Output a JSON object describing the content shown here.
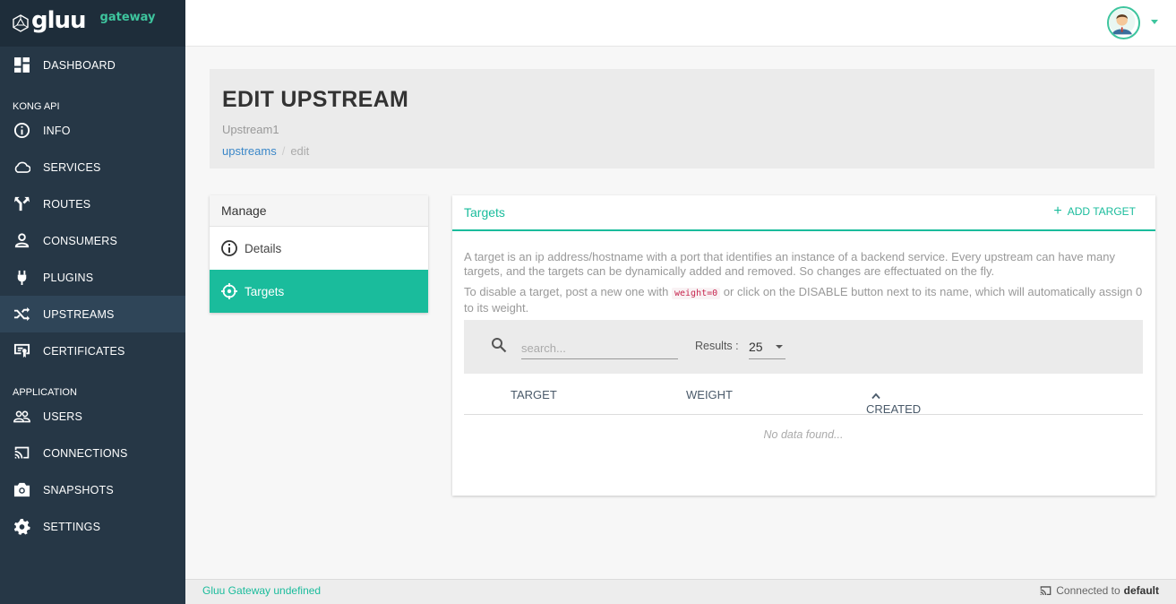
{
  "brand": {
    "name": "gluu",
    "sub": "gateway"
  },
  "sidebar": {
    "dashboard": "DASHBOARD",
    "kong_section": "KONG API",
    "kong_items": [
      {
        "label": "INFO",
        "icon": "info-icon"
      },
      {
        "label": "SERVICES",
        "icon": "cloud-icon"
      },
      {
        "label": "ROUTES",
        "icon": "fork-icon"
      },
      {
        "label": "CONSUMERS",
        "icon": "person-icon"
      },
      {
        "label": "PLUGINS",
        "icon": "plug-icon"
      },
      {
        "label": "UPSTREAMS",
        "icon": "shuffle-icon",
        "active": true
      },
      {
        "label": "CERTIFICATES",
        "icon": "certificate-icon"
      }
    ],
    "app_section": "APPLICATION",
    "app_items": [
      {
        "label": "USERS",
        "icon": "users-icon"
      },
      {
        "label": "CONNECTIONS",
        "icon": "cast-icon"
      },
      {
        "label": "SNAPSHOTS",
        "icon": "camera-icon"
      },
      {
        "label": "SETTINGS",
        "icon": "gear-icon"
      }
    ]
  },
  "header": {
    "title": "EDIT UPSTREAM",
    "subtitle": "Upstream1",
    "breadcrumb_link": "upstreams",
    "breadcrumb_sep": "/",
    "breadcrumb_current": "edit"
  },
  "manage": {
    "title": "Manage",
    "items": [
      {
        "label": "Details",
        "icon": "info-icon"
      },
      {
        "label": "Targets",
        "icon": "crosshair-icon",
        "active": true
      }
    ]
  },
  "targets": {
    "title": "Targets",
    "add_label": "ADD TARGET",
    "desc1": "A target is an ip address/hostname with a port that identifies an instance of a backend service. Every upstream can have many targets, and the targets can be dynamically added and removed. So changes are effectuated on the fly.",
    "desc2_pre": "To disable a target, post a new one with ",
    "desc2_code": "weight=0",
    "desc2_post": " or click on the DISABLE button next to its name, which will automatically assign 0 to its weight.",
    "search_placeholder": "search...",
    "results_label": "Results :",
    "results_value": "25",
    "columns": [
      "TARGET",
      "WEIGHT",
      "CREATED"
    ],
    "empty": "No data found..."
  },
  "footer": {
    "version": "Gluu Gateway undefined",
    "connected_pre": "Connected to",
    "connected_to": "default"
  },
  "colors": {
    "accent": "#1abc9c",
    "sidebar": "#263746",
    "link": "#3a87c8"
  }
}
